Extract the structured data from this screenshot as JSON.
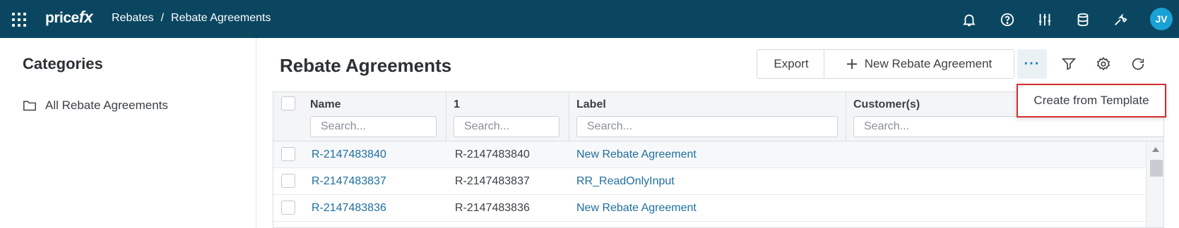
{
  "brand": {
    "logo_text": "price",
    "logo_accent": "fx"
  },
  "breadcrumb": {
    "parent": "Rebates",
    "separator": "/",
    "current": "Rebate Agreements"
  },
  "user": {
    "initials": "JV"
  },
  "topbar_icons": [
    "bell-icon",
    "help-icon",
    "sliders-icon",
    "database-icon",
    "wrench-icon"
  ],
  "sidebar": {
    "title": "Categories",
    "items": [
      {
        "label": "All Rebate Agreements",
        "icon": "folder-icon"
      }
    ]
  },
  "page": {
    "title": "Rebate Agreements"
  },
  "toolbar": {
    "export_label": "Export",
    "new_label": "New Rebate Agreement",
    "more_label": "···"
  },
  "menu": {
    "items": [
      {
        "label": "Create from Template"
      }
    ]
  },
  "table": {
    "columns": [
      {
        "header": "Name",
        "placeholder": "Search..."
      },
      {
        "header": "1",
        "placeholder": "Search..."
      },
      {
        "header": "Label",
        "placeholder": "Search..."
      },
      {
        "header": "Customer(s)",
        "placeholder": "Search..."
      }
    ],
    "rows": [
      {
        "name": "R-2147483840",
        "id": "R-2147483840",
        "label": "New Rebate Agreement",
        "customers": ""
      },
      {
        "name": "R-2147483837",
        "id": "R-2147483837",
        "label": "RR_ReadOnlyInput",
        "customers": ""
      },
      {
        "name": "R-2147483836",
        "id": "R-2147483836",
        "label": "New Rebate Agreement",
        "customers": ""
      }
    ]
  },
  "colors": {
    "topbar": "#0a4660",
    "accent": "#1aa1d6",
    "link": "#1e6f9f",
    "highlight_border": "#d32f2f"
  }
}
